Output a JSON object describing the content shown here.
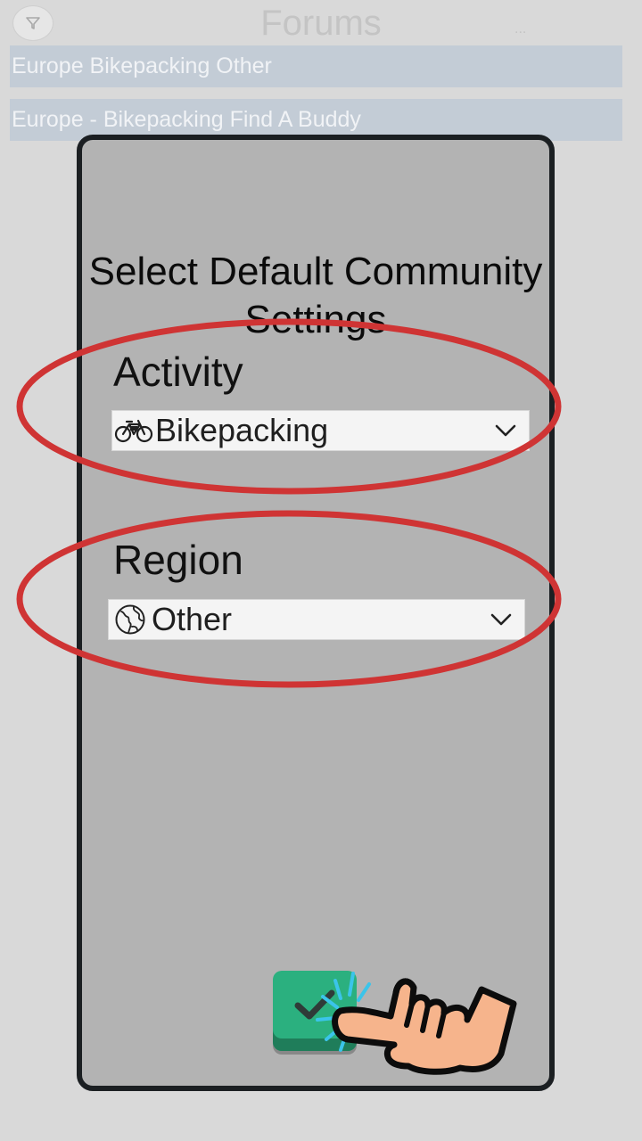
{
  "header": {
    "title": "Forums",
    "more_label": "...",
    "filter_icon": "filter-icon"
  },
  "forum_list": [
    {
      "label": "Europe Bikepacking Other"
    },
    {
      "label": "Europe - Bikepacking Find A Buddy"
    }
  ],
  "dialog": {
    "title": "Select Default Community Settings",
    "activity": {
      "label": "Activity",
      "value": "Bikepacking",
      "icon": "bicycle-icon"
    },
    "region": {
      "label": "Region",
      "value": "Other",
      "icon": "globe-icon"
    },
    "confirm_icon": "checkmark-icon"
  },
  "colors": {
    "annotation_ellipse": "#cf3434",
    "confirm_button": "#2bb07f",
    "modal_background": "#b3b3b3",
    "list_row": "#c3ccd6"
  }
}
